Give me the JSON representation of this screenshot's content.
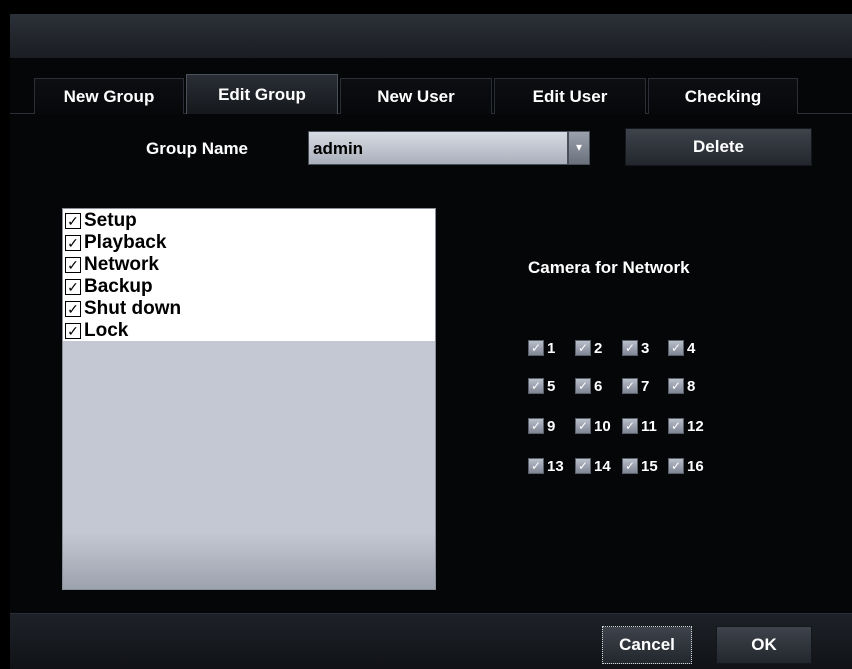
{
  "tabs": [
    {
      "label": "New Group"
    },
    {
      "label": "Edit Group"
    },
    {
      "label": "New User"
    },
    {
      "label": "Edit User"
    },
    {
      "label": "Checking"
    }
  ],
  "active_tab": "Edit Group",
  "group": {
    "label": "Group Name",
    "value": "admin",
    "dropdown_icon": "chevron-down-icon",
    "delete_label": "Delete"
  },
  "permissions": [
    {
      "label": "Setup",
      "checked": true
    },
    {
      "label": "Playback",
      "checked": true
    },
    {
      "label": "Network",
      "checked": true
    },
    {
      "label": "Backup",
      "checked": true
    },
    {
      "label": "Shut down",
      "checked": true
    },
    {
      "label": "Lock",
      "checked": true
    }
  ],
  "camera": {
    "title": "Camera for Network",
    "items": [
      {
        "label": "1",
        "checked": true
      },
      {
        "label": "2",
        "checked": true
      },
      {
        "label": "3",
        "checked": true
      },
      {
        "label": "4",
        "checked": true
      },
      {
        "label": "5",
        "checked": true
      },
      {
        "label": "6",
        "checked": true
      },
      {
        "label": "7",
        "checked": true
      },
      {
        "label": "8",
        "checked": true
      },
      {
        "label": "9",
        "checked": true
      },
      {
        "label": "10",
        "checked": true
      },
      {
        "label": "11",
        "checked": true
      },
      {
        "label": "12",
        "checked": true
      },
      {
        "label": "13",
        "checked": true
      },
      {
        "label": "14",
        "checked": true
      },
      {
        "label": "15",
        "checked": true
      },
      {
        "label": "16",
        "checked": true
      }
    ]
  },
  "footer": {
    "cancel_label": "Cancel",
    "ok_label": "OK"
  },
  "colors": {
    "background": "#000000",
    "list_bg": "#c4c8d2",
    "select_bg": "#c9ced8"
  }
}
